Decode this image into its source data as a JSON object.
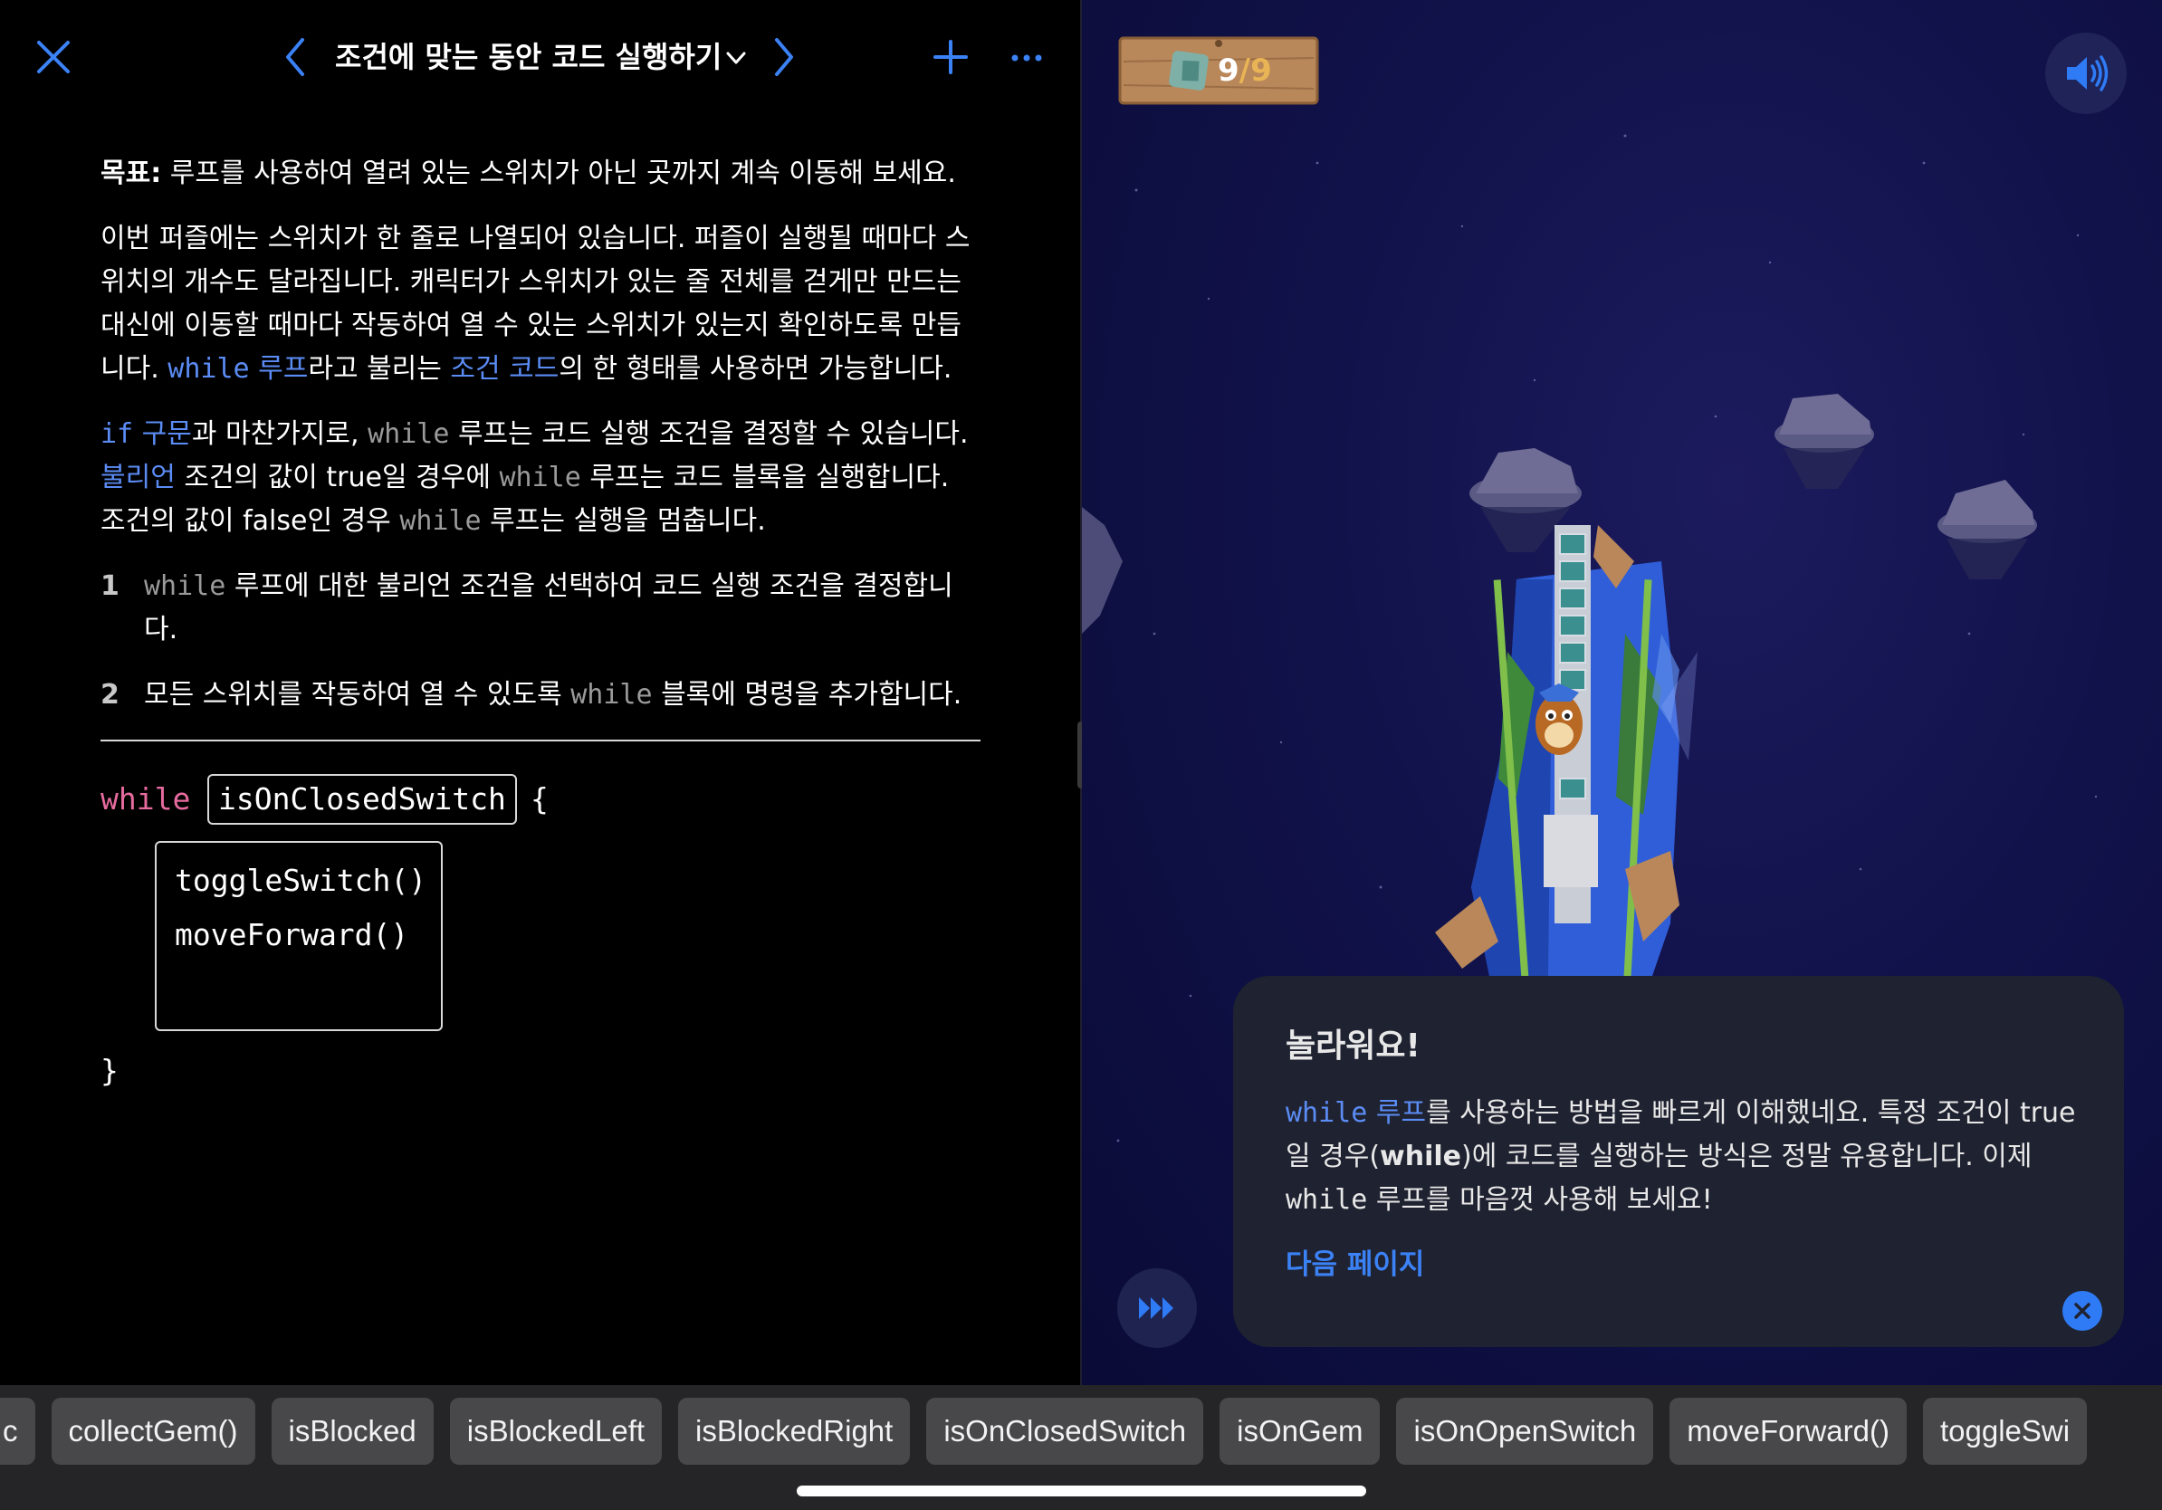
{
  "header": {
    "title": "조건에 맞는 동안 코드 실행하기",
    "accent": "#3b82f6"
  },
  "content": {
    "goal_label": "목표:",
    "goal_text": " 루프를 사용하여 열려 있는 스위치가 아닌 곳까지 계속 이동해 보세요.",
    "para1_text": "이번 퍼즐에는 스위치가 한 줄로 나열되어 있습니다. 퍼즐이 실행될 때마다 스위치의 개수도 달라집니다. 캐릭터가 스위치가 있는 줄 전체를 걷게만 만드는 대신에 이동할 때마다 작동하여 열 수 있는 스위치가 있는지 확인하도록 만듭니다. ",
    "para1_kw1_code": "while",
    "para1_kw1_word": " 루프",
    "para1_mid": "라고 불리는 ",
    "para1_kw2": "조건 코드",
    "para1_end": "의 한 형태를 사용하면 가능합니다.",
    "para2_kw1_code": "if",
    "para2_kw1_word": " 구문",
    "para2_t1": "과 마찬가지로, ",
    "para2_code1": "while",
    "para2_t2": " 루프는 코드 실행 조건을 결정할 수 있습니다. ",
    "para2_kw2": "불리언",
    "para2_t3": " 조건의 값이 true일 경우에 ",
    "para2_code2": "while",
    "para2_t4": " 루프는 코드 블록을 실행합니다. 조건의 값이 false인 경우 ",
    "para2_code3": "while",
    "para2_t5": " 루프는 실행을 멈춥니다.",
    "steps": [
      {
        "num": "1",
        "code": "while",
        "text": " 루프에 대한 불리언 조건을 선택하여 코드 실행 조건을 결정합니다."
      },
      {
        "num": "2",
        "text_before": "모든 스위치를 작동하여 열 수 있도록 ",
        "code": "while",
        "text_after": " 블록에 명령을 추가합니다."
      }
    ]
  },
  "code": {
    "keyword": "while",
    "condition": "isOnClosedSwitch",
    "open_brace": "{",
    "lines": [
      "toggleSwitch()",
      "moveForward()"
    ],
    "close_brace": "}",
    "keyword_color": "#e66b9e"
  },
  "game": {
    "gems_collected": "9",
    "gems_separator": "/",
    "gems_total": "9",
    "background_color": "#11124a"
  },
  "hint": {
    "title": "놀라워요!",
    "kw_code": "while",
    "kw_word": " 루프",
    "body1": "를 사용하는 방법을 빠르게 이해했네요. 특정 조건이 true일 경우(",
    "body_bold": "while",
    "body2": ")에 코드를 실행하는 방식은 정말 유용합니다. 이제 ",
    "body_code": "while",
    "body3": " 루프를 마음껏 사용해 보세요!",
    "next_link": "다음 페이지"
  },
  "shortcuts": [
    "c",
    "collectGem()",
    "isBlocked",
    "isBlockedLeft",
    "isBlockedRight",
    "isOnClosedSwitch",
    "isOnGem",
    "isOnOpenSwitch",
    "moveForward()",
    "toggleSwi"
  ]
}
